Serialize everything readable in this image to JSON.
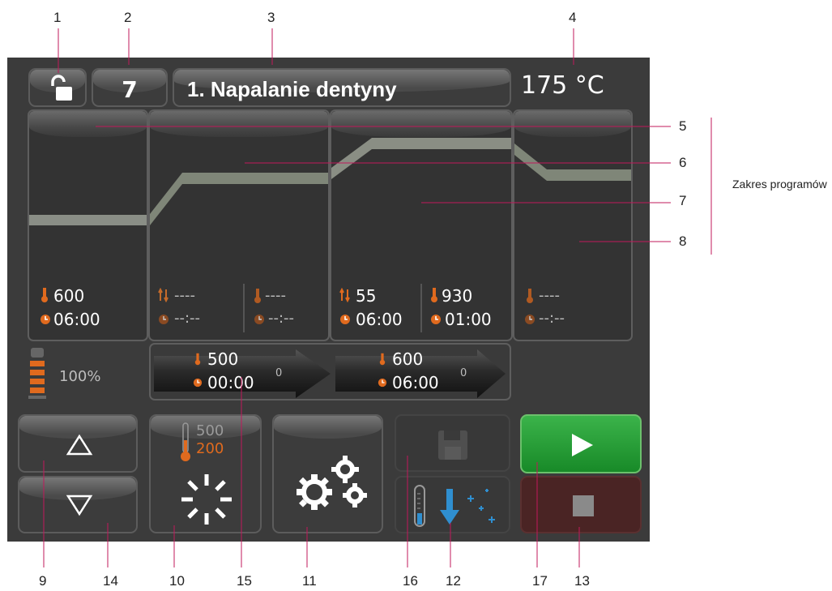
{
  "header": {
    "program_number": "7",
    "program_name": "1. Napalanie dentyny",
    "temperature": "175 °C"
  },
  "segments": [
    {
      "rate": "",
      "hold_temp": "600",
      "time_a": "06:00",
      "time_b": ""
    },
    {
      "rate": "----",
      "hold_temp": "----",
      "time_a": "--:--",
      "time_b": "--:--"
    },
    {
      "rate": "55",
      "hold_temp": "930",
      "time_a": "06:00",
      "time_b": "01:00"
    },
    {
      "rate": "",
      "hold_temp": "----",
      "time_a": "--:--",
      "time_b": ""
    }
  ],
  "status": {
    "vacuum_level": "100%"
  },
  "progress": {
    "step1_temp": "500",
    "step1_time": "00:00",
    "step1_count": "0",
    "step2_temp": "600",
    "step2_time": "06:00",
    "step2_count": "0"
  },
  "standby": {
    "temp_top": "500",
    "temp_bottom": "200"
  },
  "colors": {
    "accent_orange": "#e06a1e",
    "start_green": "#1a9a2c",
    "stop_red": "#4a2424",
    "cool_blue": "#2f8fd0"
  },
  "icons": {
    "lock": "unlock-icon",
    "up": "triangle-up-icon",
    "down": "triangle-down-icon",
    "standby": "standby-icon",
    "settings": "gears-icon",
    "save": "floppy-icon",
    "cooling": "cooling-icon",
    "start": "play-icon",
    "stop": "stop-icon"
  },
  "callouts": {
    "n1": "1",
    "n2": "2",
    "n3": "3",
    "n4": "4",
    "n5": "5",
    "n6": "6",
    "n7": "7",
    "n8": "8",
    "n9": "9",
    "n14": "14",
    "n10": "10",
    "n15": "15",
    "n11": "11",
    "n16": "16",
    "n12": "12",
    "n17": "17",
    "n13": "13",
    "range_label": "Zakres programów"
  }
}
